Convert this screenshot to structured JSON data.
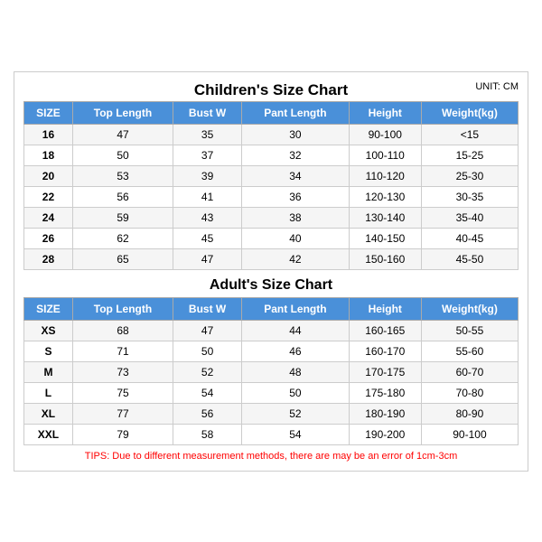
{
  "mainTitle": "Children's Size Chart",
  "unitLabel": "UNIT: CM",
  "childrenHeaders": [
    "SIZE",
    "Top Length",
    "Bust W",
    "Pant Length",
    "Height",
    "Weight(kg)"
  ],
  "childrenRows": [
    [
      "16",
      "47",
      "35",
      "30",
      "90-100",
      "<15"
    ],
    [
      "18",
      "50",
      "37",
      "32",
      "100-110",
      "15-25"
    ],
    [
      "20",
      "53",
      "39",
      "34",
      "110-120",
      "25-30"
    ],
    [
      "22",
      "56",
      "41",
      "36",
      "120-130",
      "30-35"
    ],
    [
      "24",
      "59",
      "43",
      "38",
      "130-140",
      "35-40"
    ],
    [
      "26",
      "62",
      "45",
      "40",
      "140-150",
      "40-45"
    ],
    [
      "28",
      "65",
      "47",
      "42",
      "150-160",
      "45-50"
    ]
  ],
  "adultTitle": "Adult's Size Chart",
  "adultHeaders": [
    "SIZE",
    "Top Length",
    "Bust W",
    "Pant Length",
    "Height",
    "Weight(kg)"
  ],
  "adultRows": [
    [
      "XS",
      "68",
      "47",
      "44",
      "160-165",
      "50-55"
    ],
    [
      "S",
      "71",
      "50",
      "46",
      "160-170",
      "55-60"
    ],
    [
      "M",
      "73",
      "52",
      "48",
      "170-175",
      "60-70"
    ],
    [
      "L",
      "75",
      "54",
      "50",
      "175-180",
      "70-80"
    ],
    [
      "XL",
      "77",
      "56",
      "52",
      "180-190",
      "80-90"
    ],
    [
      "XXL",
      "79",
      "58",
      "54",
      "190-200",
      "90-100"
    ]
  ],
  "tipsText": "TIPS: Due to different measurement methods, there are may be an error of 1cm-3cm"
}
